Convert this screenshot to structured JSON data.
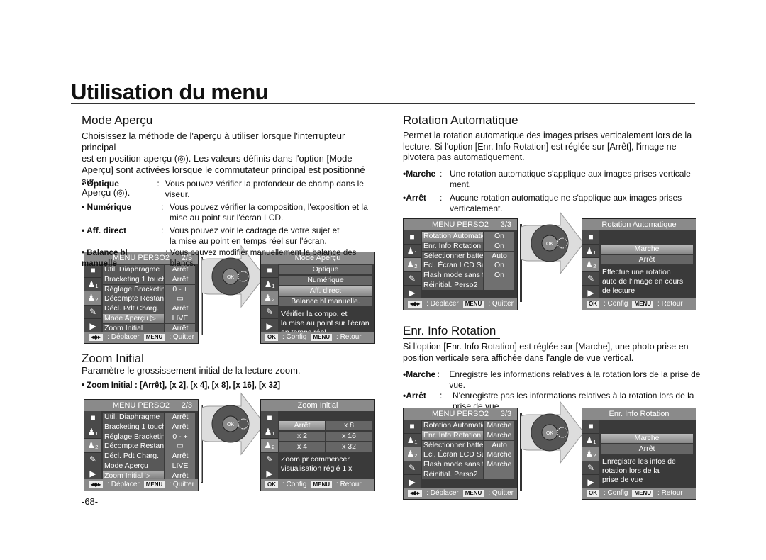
{
  "page_title": "Utilisation du menu",
  "page_number": "-68-",
  "mode_apercu": {
    "heading": "Mode Aperçu",
    "intro": [
      "Choisissez la méthode de l'aperçu à utiliser lorsque l'interrupteur principal",
      "est en position aperçu (◎). Les valeurs définis dans l'option [Mode",
      "Aperçu] sont activées lorsque le commutateur principal est positionné sur",
      "Aperçu (◎)."
    ],
    "items": [
      {
        "term": "Optique",
        "desc": [
          "Vous pouvez vérifier la profondeur de champ dans le viseur."
        ]
      },
      {
        "term": "Numérique",
        "desc": [
          "Vous pouvez vérifier la composition, l'exposition et la",
          "mise au point sur l'écran LCD."
        ]
      },
      {
        "term": "Aff. direct",
        "desc": [
          "Vous pouvez voir le cadrage de votre sujet et",
          "la mise au point en temps réel sur l'écran."
        ]
      }
    ],
    "balance": {
      "term": "Balance bl manuelle",
      "desc": "Vous pouvez modifier manuellement la balance des blancs."
    }
  },
  "zoom_initial": {
    "heading": "Zoom Initial",
    "intro": "Paramètre le grossissement initial de la lecture zoom.",
    "options_line": "• Zoom Initial : [Arrêt], [x 2], [x 4], [x 8], [x 16], [x 32]"
  },
  "rotation_auto": {
    "heading": "Rotation Automatique",
    "intro": [
      "Permet la rotation automatique des images prises verticalement lors de la",
      "lecture. Si l'option [Enr. Info Rotation] est réglée sur [Arrêt], l'image ne",
      "pivotera pas automatiquement."
    ],
    "items": [
      {
        "term": "•Marche",
        "desc": [
          "Une rotation automatique s'applique aux images prises verticale",
          "ment."
        ]
      },
      {
        "term": "•Arrêt",
        "desc": [
          "Aucune rotation automatique ne s'applique aux images prises",
          "verticalement."
        ]
      }
    ]
  },
  "enr_info": {
    "heading": "Enr. Info Rotation",
    "intro": [
      "Si l'option [Enr. Info Rotation] est réglée sur [Marche], une photo prise en",
      "position verticale sera affichée dans l'angle de vue vertical."
    ],
    "items": [
      {
        "term": "•Marche",
        "desc": [
          "Enregistre les informations relatives à la rotation lors de la prise de vue."
        ]
      },
      {
        "term": "•Arrêt",
        "desc": [
          "N'enregistre pas les informations relatives à la rotation lors de la",
          "prise de vue."
        ]
      }
    ]
  },
  "screens": {
    "common": {
      "move": ": Déplacer",
      "quit": ": Quitter",
      "config": ": Config",
      "back": ": Retour",
      "menu_key": "MENU",
      "ok_key": "OK",
      "arrows_key": "◂◆▸"
    },
    "s1": {
      "title": "MENU PERSO2",
      "page": "2/3",
      "tab": 2,
      "rows": [
        [
          "Util. Diaphragme",
          "Arrêt",
          0
        ],
        [
          "Bracketing 1 touche",
          "Arrêt",
          0
        ],
        [
          "Réglage Bracketing",
          "0 - +",
          0
        ],
        [
          "Décompte Restant",
          "▭",
          0
        ],
        [
          "Décl. Pdt Charg.",
          "Arrêt",
          0
        ],
        [
          "Mode Aperçu ▷",
          "LIVE",
          1
        ],
        [
          "Zoom Initial",
          "Arrêt",
          0
        ]
      ]
    },
    "s2": {
      "title": "Mode Aperçu",
      "tab": 2,
      "options": [
        [
          "Optique",
          0
        ],
        [
          "Numérique",
          0
        ],
        [
          "Aff. direct",
          1
        ],
        [
          "Balance bl manuelle.",
          0
        ]
      ],
      "desc": [
        "Vérifier la compo. et",
        "la mise au point sur l'écran",
        "en temps réel"
      ]
    },
    "s3": {
      "title": "MENU PERSO2",
      "page": "2/3",
      "tab": 2,
      "rows": [
        [
          "Util. Diaphragme",
          "Arrêt",
          0
        ],
        [
          "Bracketing 1 touche",
          "Arrêt",
          0
        ],
        [
          "Réglage Bracketing",
          "0 - +",
          0
        ],
        [
          "Décompte Restant",
          "▭",
          0
        ],
        [
          "Décl. Pdt Charg.",
          "Arrêt",
          0
        ],
        [
          "Mode Aperçu",
          "LIVE",
          0
        ],
        [
          "Zoom Initial ▷",
          "Arrêt",
          1
        ]
      ]
    },
    "s4": {
      "title": "Zoom Initial",
      "tab": 2,
      "grid": [
        [
          "Arrêt",
          1
        ],
        [
          "x 8",
          0
        ],
        [
          "x 2",
          0
        ],
        [
          "x 16",
          0
        ],
        [
          "x 4",
          0
        ],
        [
          "x 32",
          0
        ]
      ],
      "desc": [
        "Zoom pr commencer",
        "visualisation réglé 1 x"
      ]
    },
    "s5": {
      "title": "MENU PERSO2",
      "page": "3/3",
      "tab": 2,
      "rows": [
        [
          "Rotation Automatique ▷",
          "On",
          1
        ],
        [
          "Enr. Info Rotation",
          "On",
          0
        ],
        [
          "Sélectionner batterie",
          "Auto",
          0
        ],
        [
          "Ecl. Écran LCD Sup.",
          "On",
          0
        ],
        [
          "Flash mode sans fil",
          "On",
          0
        ],
        [
          "Réinitial. Perso2",
          "",
          0
        ]
      ]
    },
    "s6": {
      "title": "Rotation Automatique",
      "tab": 2,
      "options": [
        [
          "Marche",
          1
        ],
        [
          "Arrêt",
          0
        ]
      ],
      "desc": [
        "Effectue une rotation",
        "auto de l'image en cours",
        "de lecture"
      ]
    },
    "s7": {
      "title": "MENU PERSO2",
      "page": "3/3",
      "tab": 2,
      "rows": [
        [
          "Rotation Automatique",
          "Marche",
          0
        ],
        [
          "Enr. Info Rotation ▷",
          "Marche",
          1
        ],
        [
          "Sélectionner batterie",
          "Auto",
          0
        ],
        [
          "Ecl. Écran LCD Sup.",
          "Marche",
          0
        ],
        [
          "Flash mode sans fil",
          "Marche",
          0
        ],
        [
          "Réinitial. Perso2",
          "",
          0
        ]
      ]
    },
    "s8": {
      "title": "Enr. Info Rotation",
      "tab": 2,
      "options": [
        [
          "Marche",
          1
        ],
        [
          "Arrêt",
          0
        ]
      ],
      "desc": [
        "Enregistre les infos de",
        "rotation lors de la",
        "prise de vue"
      ]
    }
  }
}
